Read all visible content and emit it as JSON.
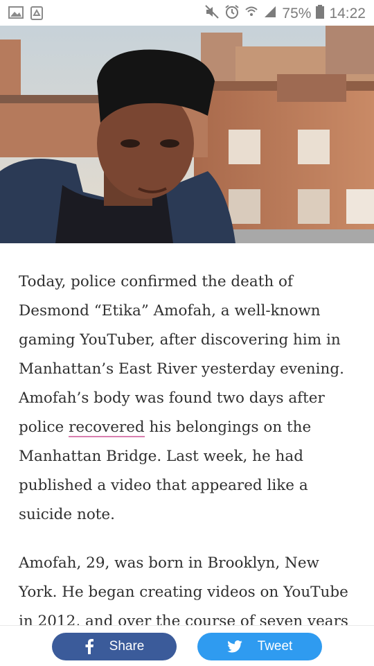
{
  "status_bar": {
    "battery": "75%",
    "time": "14:22",
    "icons": [
      "gallery-icon",
      "recycle-icon",
      "mute-icon",
      "alarm-icon",
      "wifi-icon",
      "signal-icon",
      "battery-icon"
    ]
  },
  "hero": {
    "image": "portrait of person on rooftop with city buildings"
  },
  "article": {
    "p1_before": "Today, police confirmed the death of Desmond “Etika” Amofah, a well-known gaming YouTuber, after discovering him in Manhattan’s East River yesterday evening. Amofah’s body was found two days after police ",
    "p1_link": "recovered",
    "p1_after": " his belongings on the Manhattan Bridge. Last week, he had published a video that appeared like a suicide note.",
    "p2": "Amofah, 29, was born in Brooklyn, New York. He began creating videos on YouTube in 2012, and over the course of seven years"
  },
  "share_bar": {
    "share_label": "Share",
    "tweet_label": "Tweet",
    "colors": {
      "facebook": "#3b5b9a",
      "twitter": "#2f9bf0"
    }
  }
}
